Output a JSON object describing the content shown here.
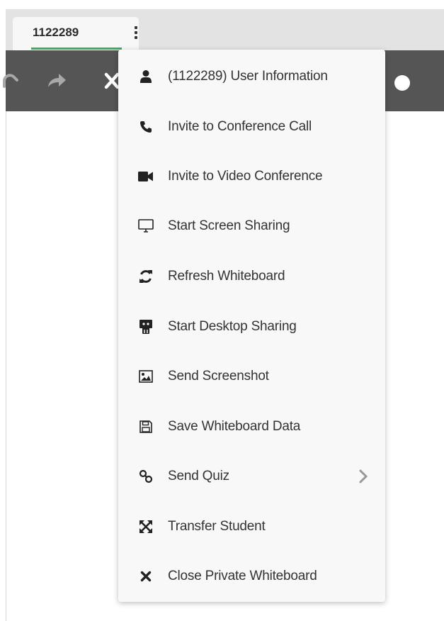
{
  "tab": {
    "label": "1122289"
  },
  "toolbar": {
    "icons": [
      "undo-icon",
      "redo-icon",
      "close-icon",
      "record-dot-icon"
    ]
  },
  "menu": {
    "items": [
      {
        "label": "(1122289) User Information",
        "icon": "user-icon"
      },
      {
        "label": "Invite to Conference Call",
        "icon": "phone-icon"
      },
      {
        "label": "Invite to Video Conference",
        "icon": "video-icon"
      },
      {
        "label": "Start Screen Sharing",
        "icon": "monitor-icon"
      },
      {
        "label": "Refresh Whiteboard",
        "icon": "refresh-icon"
      },
      {
        "label": "Start Desktop Sharing",
        "icon": "desktop-share-icon"
      },
      {
        "label": "Send Screenshot",
        "icon": "image-icon"
      },
      {
        "label": "Save Whiteboard Data",
        "icon": "save-icon"
      },
      {
        "label": "Send Quiz",
        "icon": "quiz-link-icon",
        "submenu": true
      },
      {
        "label": "Transfer Student",
        "icon": "transfer-arrows-icon"
      },
      {
        "label": "Close Private Whiteboard",
        "icon": "close-icon"
      }
    ]
  },
  "colors": {
    "tab_bar": "#e3e3e3",
    "tab_active_underline": "#2fb45a",
    "toolbar": "#555555",
    "menu_background": "#f8f8f8",
    "text": "#333333"
  }
}
